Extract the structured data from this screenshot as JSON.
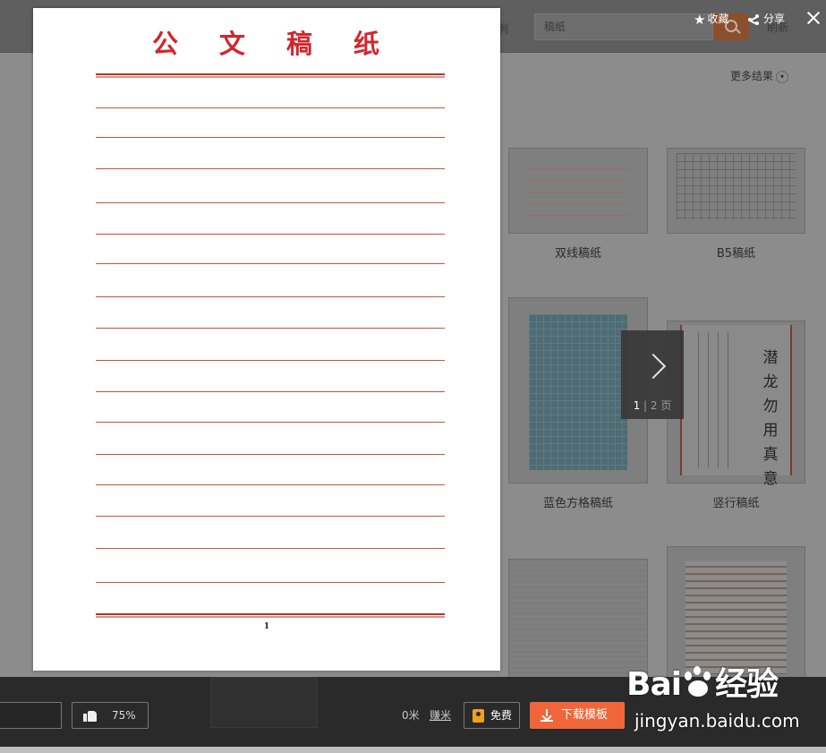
{
  "background": {
    "search_value": "稿纸",
    "partial_tab": "例",
    "refresh_label": "刷新",
    "more_results": "更多结果",
    "cards": [
      {
        "label": "双线稿纸"
      },
      {
        "label": "B5稿纸"
      },
      {
        "label": "蓝色方格稿纸"
      },
      {
        "label": "竖行稿纸"
      }
    ],
    "vertical_calligraphy": [
      "潜",
      "龙",
      "勿",
      "用",
      "真",
      "意"
    ]
  },
  "preview": {
    "title_chars": [
      "公",
      "文",
      "稿",
      "纸"
    ],
    "page_number": "1",
    "pager": {
      "current": "1",
      "separator": "|",
      "total": "2",
      "unit": "页"
    }
  },
  "top_actions": {
    "favorite_label": "收藏",
    "share_label": "分享"
  },
  "bottom_bar": {
    "like_percent": "75%",
    "rice_count": "0米",
    "earn_label": "赚米",
    "free_label": "免费",
    "download_label": "下载模板"
  },
  "watermark": {
    "logo_left": "Bai",
    "logo_right": "经验",
    "url": "jingyan.baidu.com"
  },
  "colors": {
    "title_red": "#d2262d",
    "rule_red": "#c9513f",
    "download_orange": "#f0653a",
    "free_icon": "#f0a020"
  }
}
